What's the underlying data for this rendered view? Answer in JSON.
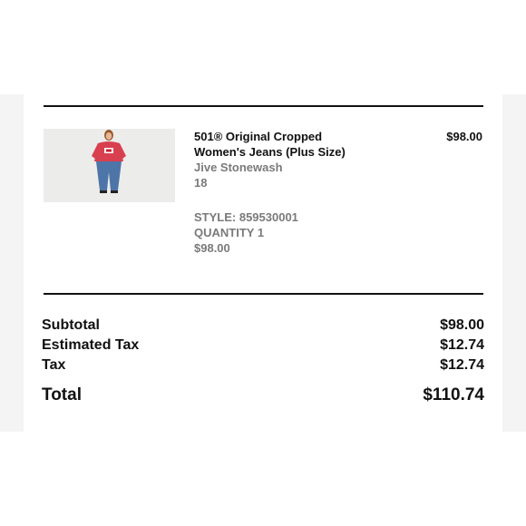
{
  "item": {
    "name": "501® Original Cropped Women's Jeans (Plus Size)",
    "color": "Jive Stonewash",
    "size": "18",
    "style": "STYLE: 859530001",
    "quantity": "QUANTITY 1",
    "unit_price": "$98.00",
    "line_price": "$98.00",
    "thumbnail": "product-photo-model-in-red-sweatshirt-and-jeans"
  },
  "totals": {
    "subtotal_label": "Subtotal",
    "subtotal_value": "$98.00",
    "estimated_tax_label": "Estimated Tax",
    "estimated_tax_value": "$12.74",
    "tax_label": "Tax",
    "tax_value": "$12.74",
    "total_label": "Total",
    "total_value": "$110.74"
  },
  "colors": {
    "text": "#111111",
    "muted_text": "#7a7a7a",
    "divider": "#111111",
    "thumbnail_bg": "#ececea"
  }
}
